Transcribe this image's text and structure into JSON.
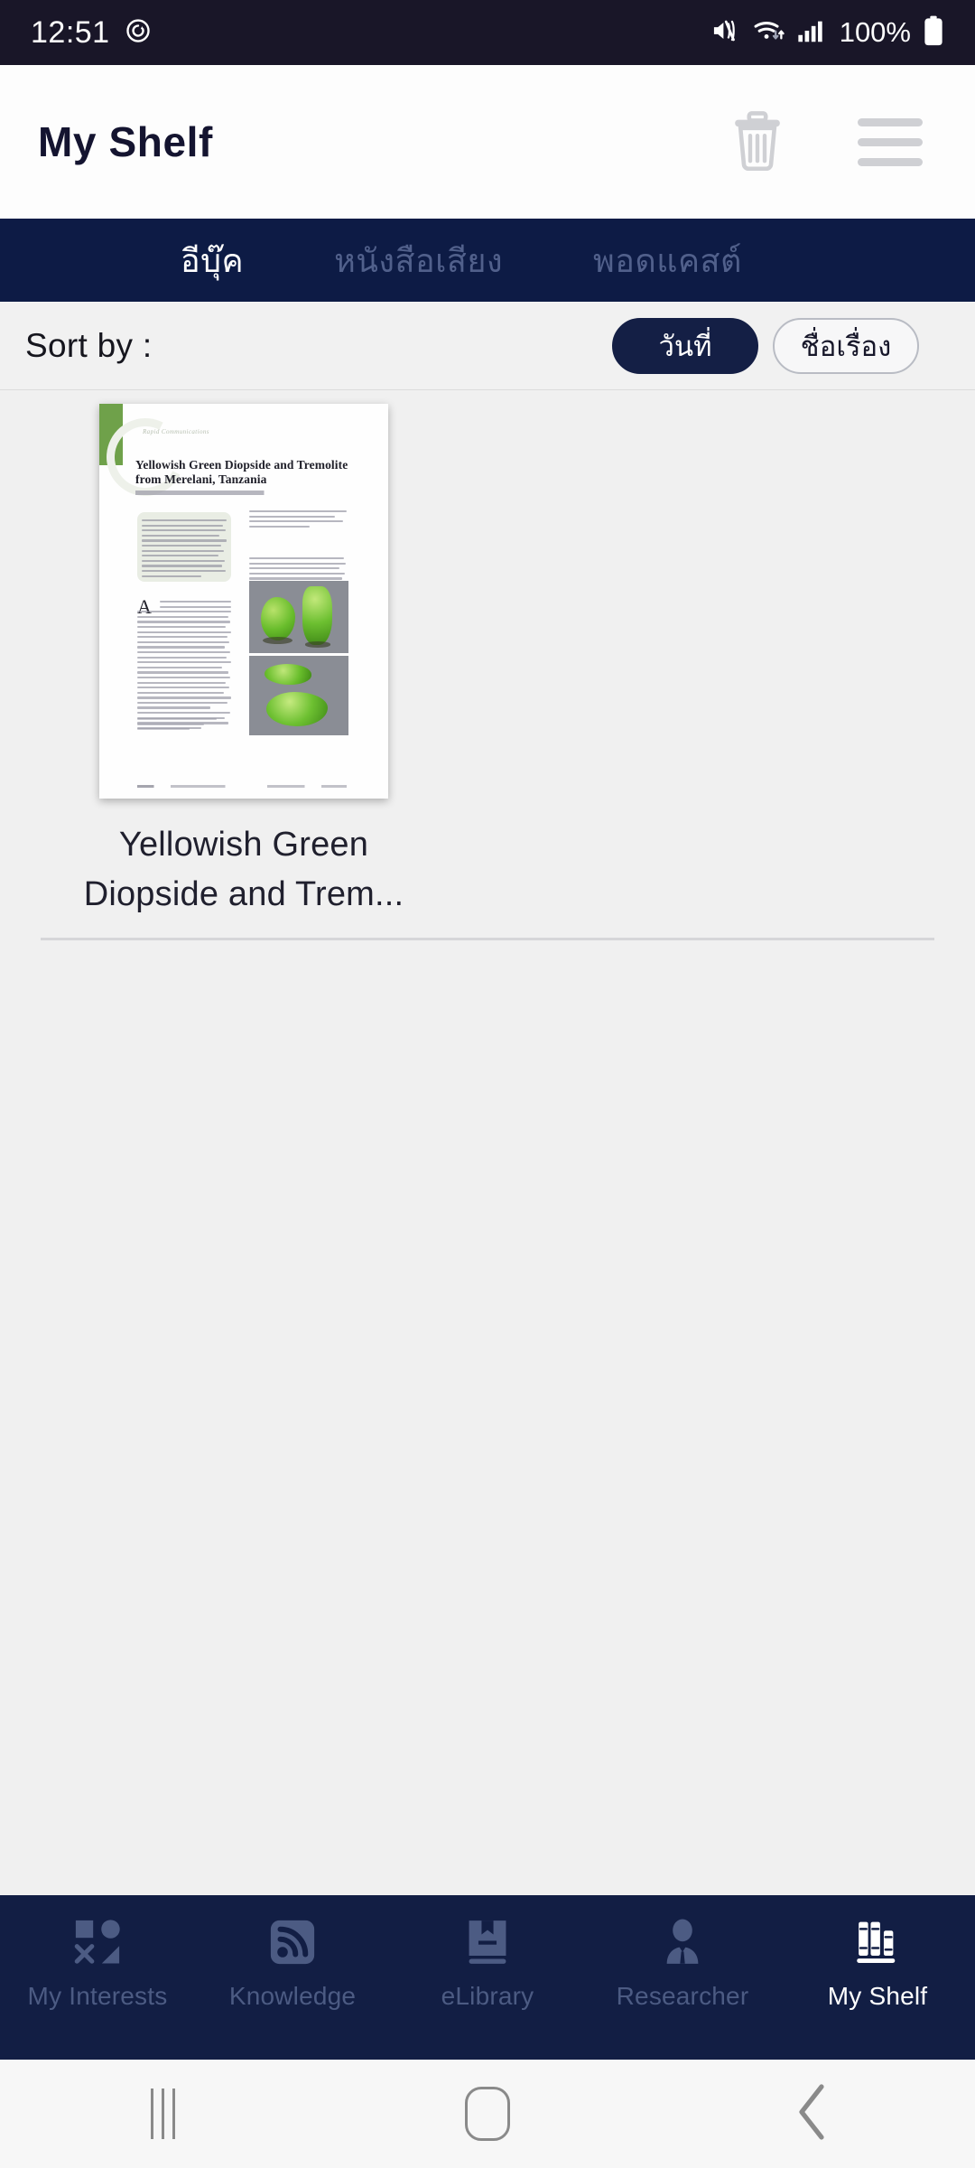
{
  "statusbar": {
    "time": "12:51",
    "battery_percent": "100%",
    "icons": [
      "alarm-icon",
      "mute-icon",
      "wifi-icon",
      "signal-icon",
      "battery-icon"
    ]
  },
  "appbar": {
    "title": "My Shelf",
    "delete_icon": "trash-icon",
    "menu_icon": "hamburger-menu-icon"
  },
  "tabs": [
    {
      "label": "อีบุ๊ค",
      "active": true
    },
    {
      "label": "หนังสือเสียง",
      "active": false
    },
    {
      "label": "พอดแคสต์",
      "active": false
    }
  ],
  "sort": {
    "label": "Sort by :",
    "options": [
      {
        "label": "วันที่",
        "active": true
      },
      {
        "label": "ชื่อเรื่อง",
        "active": false
      }
    ]
  },
  "books": [
    {
      "title": "Yellowish Green Diopside and Trem...",
      "title_line1": "Yellowish Green",
      "title_line2": "Diopside and Trem...",
      "cover": {
        "kicker": "Rapid Communications",
        "heading": "Yellowish Green Diopside and Tremolite from Merelani, Tanzania",
        "accent_color": "#6fa14a",
        "gem_color": "#6fbd2e"
      }
    }
  ],
  "bottom_nav": [
    {
      "label": "My Interests",
      "icon": "shapes-grid-icon",
      "active": false
    },
    {
      "label": "Knowledge",
      "icon": "rss-feed-icon",
      "active": false
    },
    {
      "label": "eLibrary",
      "icon": "bookmark-book-icon",
      "active": false
    },
    {
      "label": "Researcher",
      "icon": "person-tie-icon",
      "active": false
    },
    {
      "label": "My Shelf",
      "icon": "bookshelf-icon",
      "active": true
    }
  ],
  "system_nav": [
    {
      "name": "recents",
      "icon": "recents-icon"
    },
    {
      "name": "home",
      "icon": "home-icon"
    },
    {
      "name": "back",
      "icon": "back-chevron-icon"
    }
  ],
  "colors": {
    "statusbar_bg": "#191628",
    "tabbar_bg": "#0d1b45",
    "bottomnav_bg": "#121e44",
    "accent_navy": "#141f45",
    "page_bg": "#f0f0f0"
  }
}
